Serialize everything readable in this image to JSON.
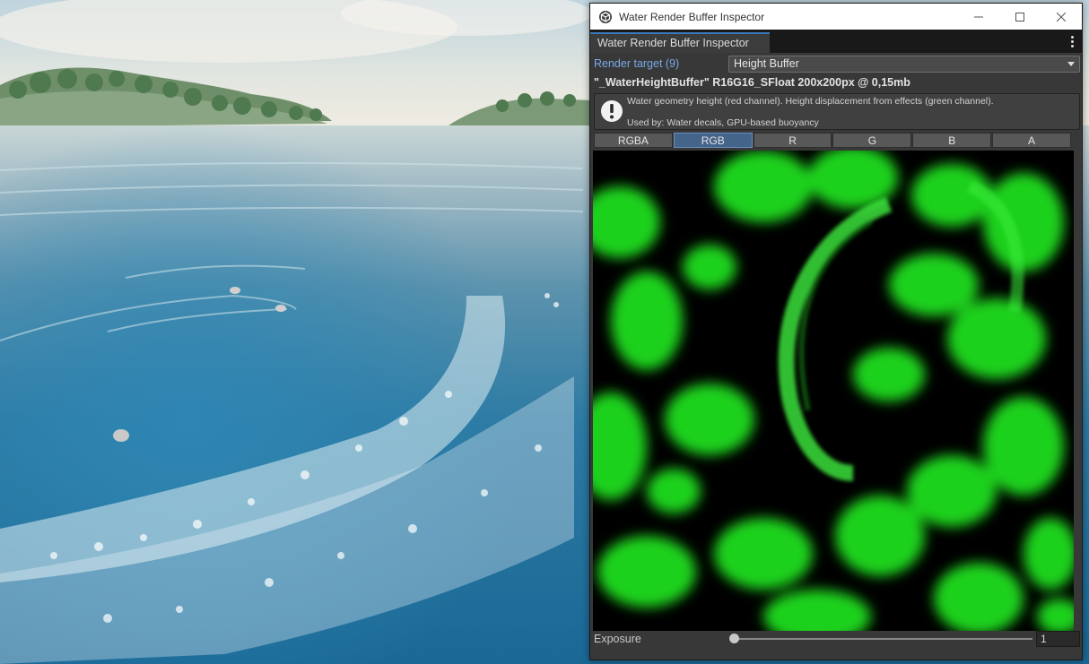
{
  "window": {
    "title": "Water Render Buffer Inspector",
    "tab_label": "Water Render Buffer Inspector",
    "app_icon": "unity-logo-icon",
    "controls": [
      "minimize-icon",
      "maximize-icon",
      "close-icon"
    ]
  },
  "render_target": {
    "label": "Render target (9)",
    "selected": "Height Buffer"
  },
  "buffer_info": "\"_WaterHeightBuffer\" R16G16_SFloat 200x200px @ 0,15mb",
  "help": {
    "icon": "info-icon",
    "line1": "Water geometry height (red channel). Height displacement from effects (green channel).",
    "line2": "Used by: Water decals, GPU-based buoyancy"
  },
  "channels": {
    "options": [
      "RGBA",
      "RGB",
      "R",
      "G",
      "B",
      "A"
    ],
    "active": "RGB"
  },
  "exposure": {
    "label": "Exposure",
    "value": "1",
    "slider_fraction": 0
  },
  "colors": {
    "accent": "#3a79bb",
    "preview_green": "#22e022",
    "window_bg": "#383838"
  }
}
